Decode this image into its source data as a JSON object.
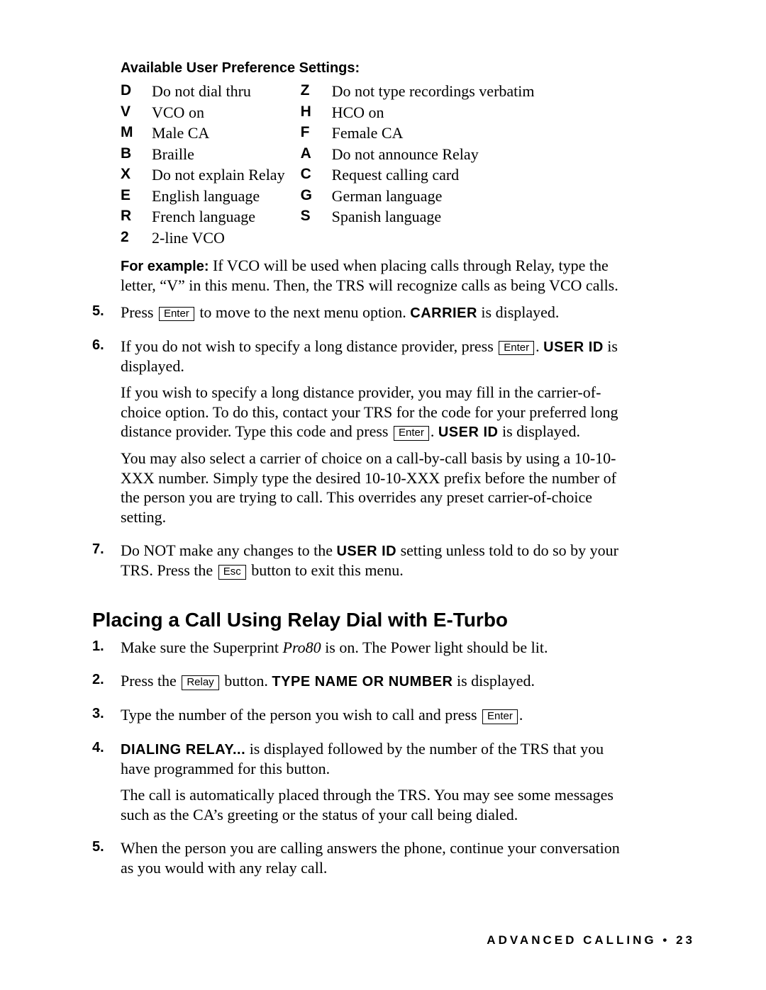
{
  "settings_heading": "Available User Preference Settings:",
  "settings_rows": [
    {
      "k1": "D",
      "v1": "Do not dial thru",
      "k2": "Z",
      "v2": "Do not type recordings verbatim"
    },
    {
      "k1": "V",
      "v1": "VCO on",
      "k2": "H",
      "v2": "HCO on"
    },
    {
      "k1": "M",
      "v1": "Male CA",
      "k2": "F",
      "v2": "Female CA"
    },
    {
      "k1": "B",
      "v1": "Braille",
      "k2": "A",
      "v2": "Do not announce Relay"
    },
    {
      "k1": "X",
      "v1": "Do not explain Relay",
      "k2": "C",
      "v2": "Request calling card"
    },
    {
      "k1": "E",
      "v1": "English language",
      "k2": "G",
      "v2": "German language"
    },
    {
      "k1": "R",
      "v1": "French language",
      "k2": "S",
      "v2": "Spanish language"
    },
    {
      "k1": "2",
      "v1": "2-line VCO",
      "k2": "",
      "v2": ""
    }
  ],
  "example_label": "For example:",
  "example_text": " If VCO will be used when placing calls through Relay, type the letter, “V” in this menu. Then, the TRS will recognize calls as being VCO calls.",
  "step5": {
    "num": "5.",
    "pre": "Press ",
    "key": "Enter",
    "mid": " to move to the next menu option. ",
    "lcd": "CARRIER",
    "post": " is displayed."
  },
  "step6": {
    "num": "6.",
    "p1_pre": "If you do not wish to specify a long distance provider, press ",
    "p1_key": "Enter",
    "p1_post": ". ",
    "p1_lcd": "USER ID",
    "p1_tail": " is displayed.",
    "p2_pre": "If you wish to specify a long distance provider, you may fill in the carrier-of-choice option. To do this, contact your TRS for the code for your preferred long distance provider. Type this code and press ",
    "p2_key": "Enter",
    "p2_post": ". ",
    "p2_lcd": "USER ID",
    "p2_tail": " is displayed.",
    "p3": "You may also select a carrier of choice on a call-by-call basis by using a 10-10-XXX number. Simply type the desired 10-10-XXX prefix before the number of the person you are trying to call. This overrides any preset carrier-of-choice setting."
  },
  "step7": {
    "num": "7.",
    "pre": "Do NOT make any changes to the ",
    "lcd": "USER ID",
    "mid": " setting unless told to do so by your TRS. Press the ",
    "key": "Esc",
    "post": " button to exit this menu."
  },
  "section2_heading": "Placing a Call Using Relay Dial with E-Turbo",
  "s2_step1": {
    "num": "1.",
    "pre": "Make sure the Superprint ",
    "italic": "Pro80",
    "post": " is on. The Power light should be lit."
  },
  "s2_step2": {
    "num": "2.",
    "pre": "Press the ",
    "key": "Relay",
    "mid": " button. ",
    "lcd": "TYPE NAME OR NUMBER",
    "post": " is displayed."
  },
  "s2_step3": {
    "num": "3.",
    "pre": "Type the number of the person you wish to call and press ",
    "key": "Enter",
    "post": "."
  },
  "s2_step4": {
    "num": "4.",
    "lcd": "DIALING RELAY...",
    "p1_tail": " is displayed followed by the number of the TRS that you have programmed for this button.",
    "p2": "The call is automatically placed through the TRS. You may see some messages such as the CA’s greeting or the status of your call being dialed."
  },
  "s2_step5": {
    "num": "5.",
    "text": "When the person you are calling answers the phone, continue your conversation as you would with any relay call."
  },
  "footer_left": "ADVANCED CALLING",
  "footer_bullet": "•",
  "footer_right": "23"
}
